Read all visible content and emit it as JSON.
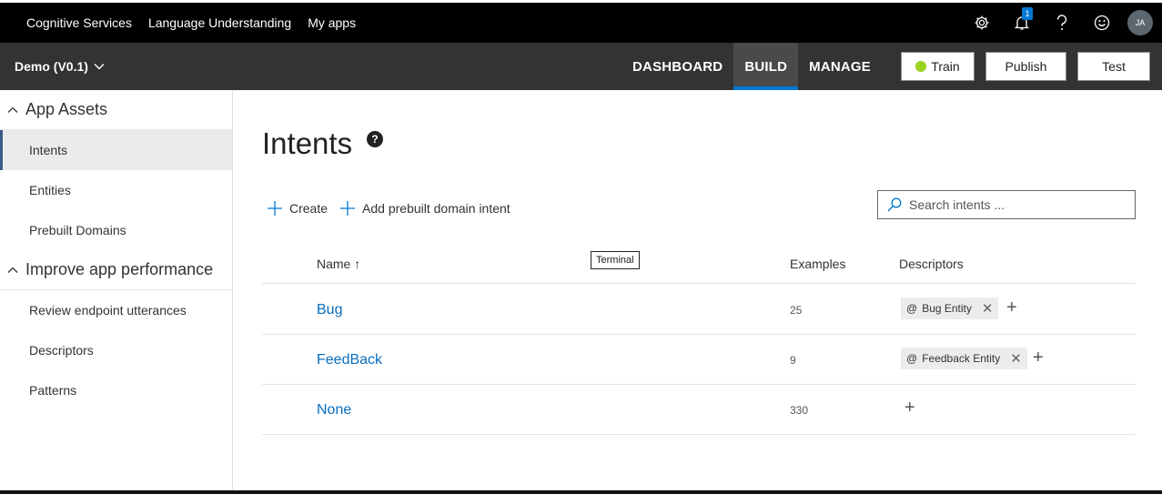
{
  "topbar": {
    "nav": [
      "Cognitive Services",
      "Language Understanding",
      "My apps"
    ],
    "notification_count": "1",
    "avatar_initials": "JA"
  },
  "appbar": {
    "app_name": "Demo (V0.1)",
    "tabs": [
      "DASHBOARD",
      "BUILD",
      "MANAGE"
    ],
    "active_tab": "BUILD",
    "train_label": "Train",
    "publish_label": "Publish",
    "test_label": "Test",
    "train_status_color": "#9bd21e"
  },
  "sidebar": {
    "group1": "App Assets",
    "items1": [
      "Intents",
      "Entities",
      "Prebuilt Domains"
    ],
    "group2": "Improve app performance",
    "items2": [
      "Review endpoint utterances",
      "Descriptors",
      "Patterns"
    ]
  },
  "main": {
    "title": "Intents",
    "help_glyph": "?",
    "create_label": "Create",
    "prebuilt_label": "Add prebuilt domain intent",
    "search_placeholder": "Search intents ...",
    "columns": {
      "name": "Name ↑",
      "examples": "Examples",
      "descriptors": "Descriptors"
    },
    "tooltip": "Terminal",
    "rows": [
      {
        "name": "Bug",
        "examples": "25",
        "descriptor": "Bug Entity"
      },
      {
        "name": "FeedBack",
        "examples": "9",
        "descriptor": "Feedback Entity"
      },
      {
        "name": "None",
        "examples": "330",
        "descriptor": ""
      }
    ]
  },
  "colors": {
    "accent": "#0078d4",
    "link": "#0a6ebd"
  }
}
